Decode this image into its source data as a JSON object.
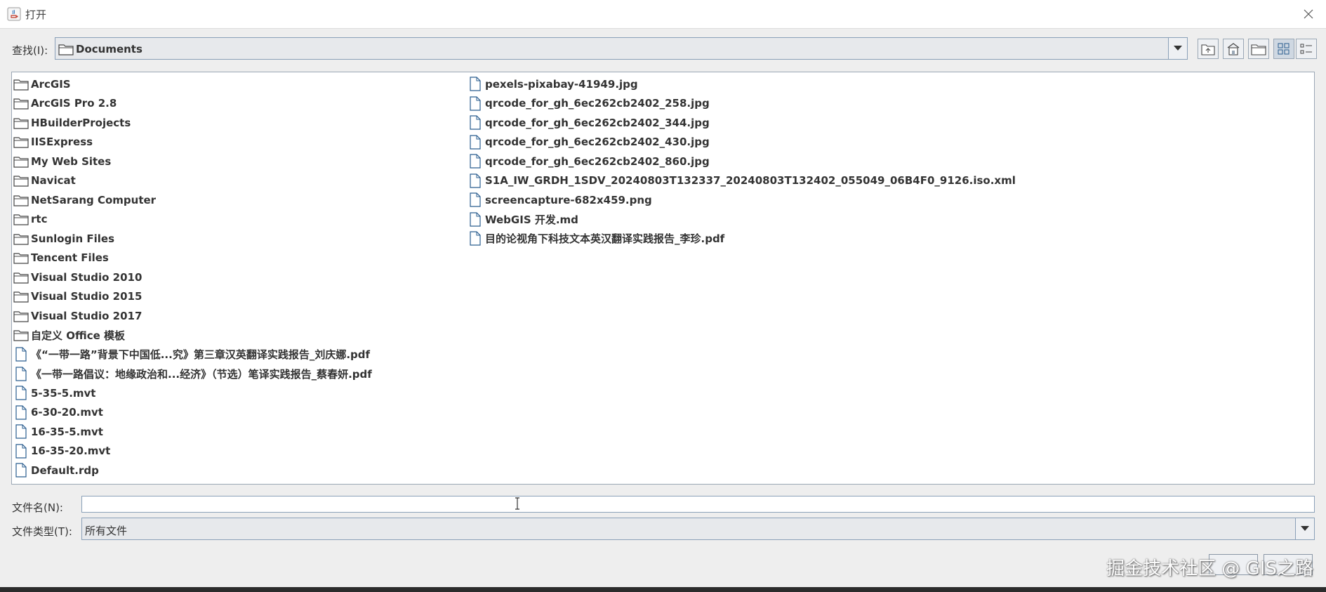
{
  "window": {
    "title": "打开"
  },
  "lookin": {
    "label": "查找(I):",
    "value": "Documents"
  },
  "toolbar": {
    "buttons": [
      {
        "name": "up-one-level-icon"
      },
      {
        "name": "home-icon"
      },
      {
        "name": "new-folder-icon"
      },
      {
        "name": "list-view-icon"
      },
      {
        "name": "details-view-icon"
      }
    ]
  },
  "files": {
    "column1": [
      {
        "name": "ArcGIS",
        "type": "folder"
      },
      {
        "name": "ArcGIS Pro 2.8",
        "type": "folder"
      },
      {
        "name": "HBuilderProjects",
        "type": "folder"
      },
      {
        "name": "IISExpress",
        "type": "folder"
      },
      {
        "name": "My Web Sites",
        "type": "folder"
      },
      {
        "name": "Navicat",
        "type": "folder"
      },
      {
        "name": "NetSarang Computer",
        "type": "folder"
      },
      {
        "name": "rtc",
        "type": "folder"
      },
      {
        "name": "Sunlogin Files",
        "type": "folder"
      },
      {
        "name": "Tencent Files",
        "type": "folder"
      },
      {
        "name": "Visual Studio 2010",
        "type": "folder"
      },
      {
        "name": "Visual Studio 2015",
        "type": "folder"
      },
      {
        "name": "Visual Studio 2017",
        "type": "folder"
      },
      {
        "name": "自定义 Office 模板",
        "type": "folder"
      },
      {
        "name": "《“一带一路”背景下中国低...究》第三章汉英翻译实践报告_刘庆娜.pdf",
        "type": "file"
      },
      {
        "name": "《一带一路倡议：地缘政治和...经济》（节选）笔译实践报告_蔡春妍.pdf",
        "type": "file"
      },
      {
        "name": "5-35-5.mvt",
        "type": "file"
      },
      {
        "name": "6-30-20.mvt",
        "type": "file"
      },
      {
        "name": "16-35-5.mvt",
        "type": "file"
      },
      {
        "name": "16-35-20.mvt",
        "type": "file"
      },
      {
        "name": "Default.rdp",
        "type": "file"
      }
    ],
    "column2": [
      {
        "name": "pexels-pixabay-41949.jpg",
        "type": "file"
      },
      {
        "name": "qrcode_for_gh_6ec262cb2402_258.jpg",
        "type": "file"
      },
      {
        "name": "qrcode_for_gh_6ec262cb2402_344.jpg",
        "type": "file"
      },
      {
        "name": "qrcode_for_gh_6ec262cb2402_430.jpg",
        "type": "file"
      },
      {
        "name": "qrcode_for_gh_6ec262cb2402_860.jpg",
        "type": "file"
      },
      {
        "name": "S1A_IW_GRDH_1SDV_20240803T132337_20240803T132402_055049_06B4F0_9126.iso.xml",
        "type": "file"
      },
      {
        "name": "screencapture-682x459.png",
        "type": "file"
      },
      {
        "name": "WebGIS 开发.md",
        "type": "file"
      },
      {
        "name": "目的论视角下科技文本英汉翻译实践报告_李珍.pdf",
        "type": "file"
      }
    ]
  },
  "filename": {
    "label": "文件名(N):",
    "value": ""
  },
  "filetype": {
    "label": "文件类型(T):",
    "value": "所有文件"
  },
  "watermark": "掘金技术社区 @ GIS之路"
}
